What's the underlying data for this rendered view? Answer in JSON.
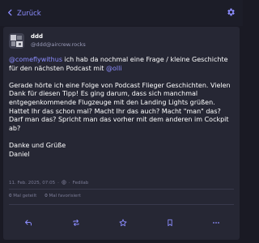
{
  "header": {
    "back_label": "Zurück"
  },
  "post": {
    "display_name": "ddd",
    "handle": "@ddd@aircrew.rocks",
    "content": {
      "mention_1": "@comeflywithus",
      "line_1_rest": " ich hab da nochmal eine Frage / kleine Geschichte für den nächsten Podcast mit ",
      "mention_2": "@olli",
      "paragraph_2": "Gerade hörte ich eine Folge von Podcast Flieger Geschichten. Vielen Dank für diesen Tipp! Es ging darum, dass sich manchmal entgegenkommende Flugzeuge mit den Landing Lights grüßen. Hattet Ihr das schon mal? Macht Ihr das auch? Macht \"man\" das? Darf man das? Spricht man das vorher mit dem anderen im Cockpit ab?",
      "closing_line_1": "Danke und Grüße",
      "closing_line_2": "Daniel"
    },
    "timestamp": "11. Feb. 2025, 07:05",
    "separator": "·",
    "client": "Fedilab",
    "boost_count": "0",
    "boost_label": "Mal geteilt",
    "fav_count": "0",
    "fav_label": "Mal favorisiert"
  },
  "colors": {
    "background": "#1a1a24",
    "card": "#262734",
    "accent": "#8c8dff",
    "muted_text": "#7a7b95"
  },
  "icons": {
    "back": "chevron-left-icon",
    "settings": "gear-icon",
    "visibility": "globe-icon",
    "reply": "reply-icon",
    "boost": "boost-icon",
    "favourite": "star-icon",
    "bookmark": "bookmark-icon",
    "more": "more-icon"
  }
}
